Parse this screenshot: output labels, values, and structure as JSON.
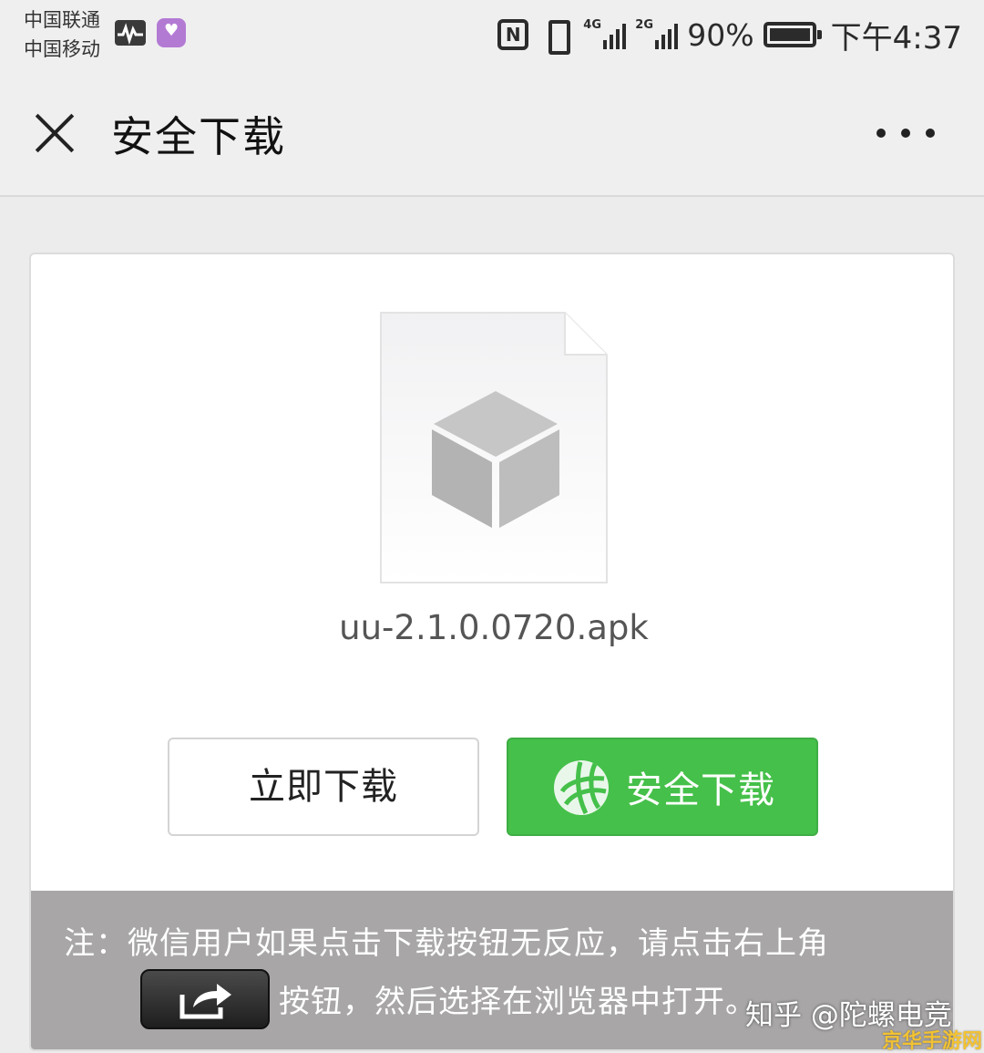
{
  "status_bar": {
    "carrier_1": "中国联通",
    "carrier_2": "中国移动",
    "net_1": "4G",
    "net_2": "2G",
    "battery": "90%",
    "battery_level": 0.9,
    "time": "下午4:37",
    "icons": [
      "activity-icon",
      "app-heart-icon",
      "nfc-icon",
      "vibrate-icon",
      "signal-icon",
      "battery-icon"
    ]
  },
  "header": {
    "title": "安全下载",
    "close_icon": "close-icon",
    "more_icon": "more-icon"
  },
  "file": {
    "name": "uu-2.1.0.0720.apk",
    "thumb_icon": "package-box-icon"
  },
  "buttons": {
    "download_now": "立即下载",
    "safe_download": "安全下载"
  },
  "notice": {
    "line1": "注：微信用户如果点击下载按钮无反应，请点击右上角",
    "line2": "按钮，然后选择在浏览器中打开。",
    "share_icon": "share-icon"
  },
  "watermarks": {
    "zhihu": "知乎 @陀螺电竞",
    "site": "京华手游网"
  },
  "colors": {
    "accent_green": "#45c04a",
    "notice_bg": "#a8a6a7",
    "page_bg": "#ececec"
  }
}
